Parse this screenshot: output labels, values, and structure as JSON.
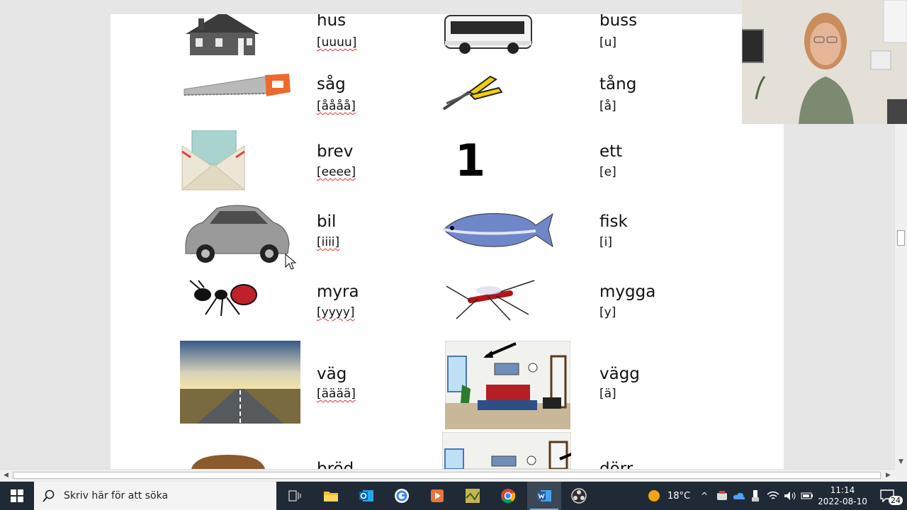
{
  "vocabulary": {
    "left": [
      {
        "word": "hus",
        "sound": "[uuuu]",
        "picture": "house"
      },
      {
        "word": "såg",
        "sound": "[åååå]",
        "picture": "saw"
      },
      {
        "word": "brev",
        "sound": "[eeee]",
        "picture": "letter-envelope"
      },
      {
        "word": "bil",
        "sound": "[iiii]",
        "picture": "car"
      },
      {
        "word": "myra",
        "sound": "[yyyy]",
        "picture": "ant"
      },
      {
        "word": "väg",
        "sound": "[ääää]",
        "picture": "road"
      },
      {
        "word": "bröd",
        "sound": "",
        "picture": "bread"
      }
    ],
    "right": [
      {
        "word": "buss",
        "sound": "[u]",
        "picture": "bus"
      },
      {
        "word": "tång",
        "sound": "[å]",
        "picture": "pliers"
      },
      {
        "word": "ett",
        "sound": "[e]",
        "picture": "number-one",
        "glyph": "1"
      },
      {
        "word": "fisk",
        "sound": "[i]",
        "picture": "fish"
      },
      {
        "word": "mygga",
        "sound": "[y]",
        "picture": "mosquito"
      },
      {
        "word": "vägg",
        "sound": "[ä]",
        "picture": "room-wall"
      },
      {
        "word": "dörr",
        "sound": "",
        "picture": "room-door"
      }
    ]
  },
  "taskbar": {
    "search_placeholder": "Skriv här för att söka",
    "apps": [
      "start-icon",
      "task-view-icon",
      "file-explorer-icon",
      "outlook-icon",
      "google-app-icon",
      "media-app-icon",
      "map-app-icon",
      "chrome-icon",
      "word-icon",
      "obs-icon"
    ],
    "temperature": "18°C",
    "time": "11:14",
    "date": "2022-08-10",
    "notification_count": "24"
  },
  "colors": {
    "taskbar": "#1f2a36",
    "word_active": "#2b579a",
    "spell_error": "#e03030"
  }
}
